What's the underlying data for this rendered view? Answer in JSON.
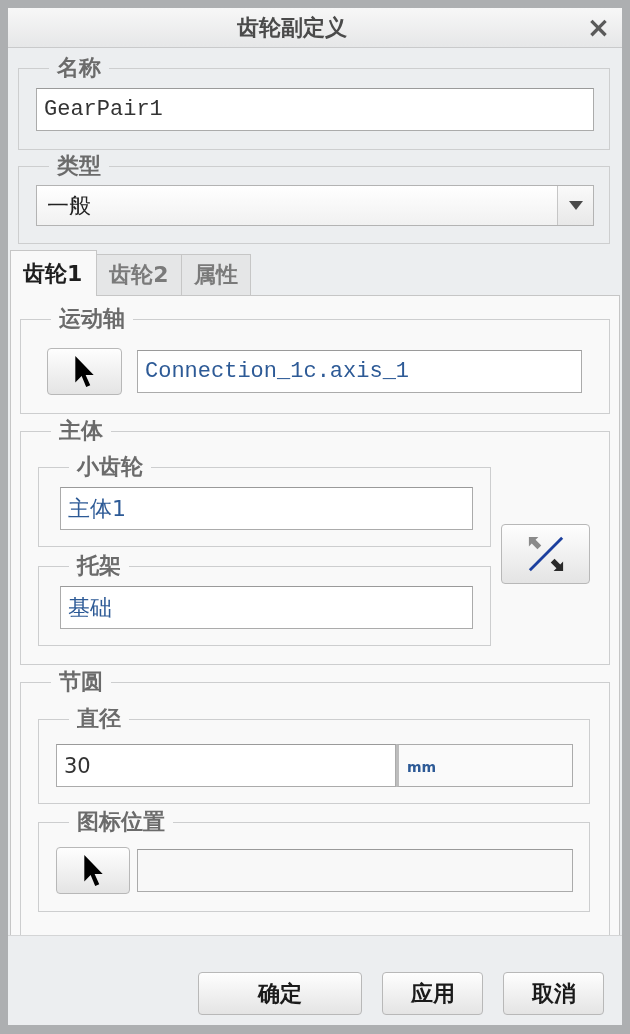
{
  "window": {
    "title": "齿轮副定义",
    "close": "×"
  },
  "name": {
    "label": "名称",
    "value": "GearPair1"
  },
  "type": {
    "label": "类型",
    "value": "一般"
  },
  "tabs": [
    {
      "label": "齿轮1",
      "selected": true
    },
    {
      "label": "齿轮2",
      "selected": false
    },
    {
      "label": "属性",
      "selected": false
    }
  ],
  "motion_axis": {
    "label": "运动轴",
    "value": "Connection_1c.axis_1"
  },
  "bodies": {
    "label": "主体",
    "pinion": {
      "label": "小齿轮",
      "value": "主体1"
    },
    "carrier": {
      "label": "托架",
      "value": "基础"
    }
  },
  "pitch_circle": {
    "label": "节圆",
    "diameter": {
      "label": "直径",
      "value": "30",
      "unit": "mm"
    },
    "icon_location": {
      "label": "图标位置"
    }
  },
  "buttons": [
    {
      "label": "确定"
    },
    {
      "label": "应用"
    },
    {
      "label": "取消"
    }
  ]
}
